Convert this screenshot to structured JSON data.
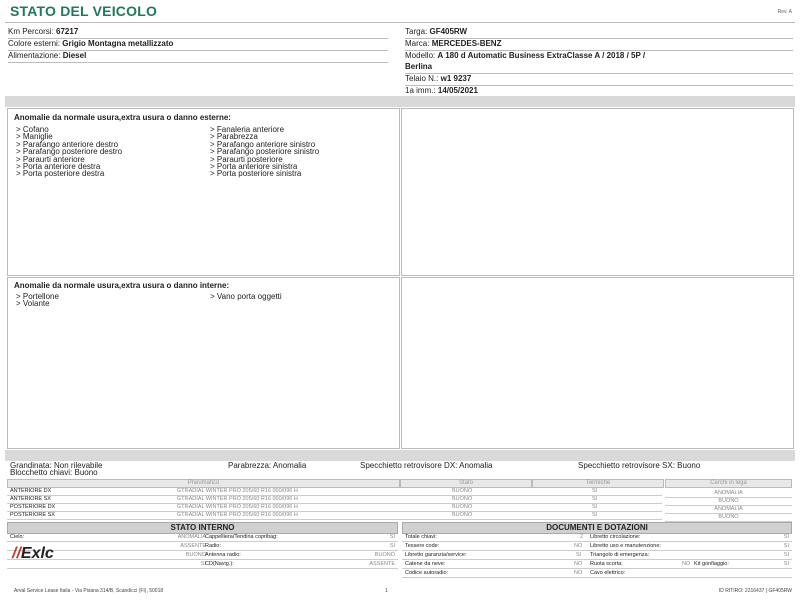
{
  "header": {
    "title": "STATO DEL VEICOLO",
    "rev": "Rev. A"
  },
  "vehicle_left": [
    {
      "label": "Km Percorsi:",
      "value": "67217"
    },
    {
      "label": "Colore esterni:",
      "value": "Grigio Montagna metallizzato"
    },
    {
      "label": "Alimentazione:",
      "value": "Diesel"
    }
  ],
  "vehicle_right": {
    "targa_label": "Targa:",
    "targa": "GF405RW",
    "marca_label": "Marca:",
    "marca": "MERCEDES-BENZ",
    "modello_label": "Modello:",
    "modello_1": "A 180 d Automatic Business ExtraClasse A / 2018 / 5P /",
    "modello_2": "Berlina",
    "telaio_label": "Telaio N.:",
    "telaio": "w1 9237",
    "imm_label": "1a imm.:",
    "imm": "14/05/2021"
  },
  "external": {
    "title": "Anomalie da normale usura,extra usura o danno esterne:",
    "col1": [
      "> Cofano",
      "> Maniglie",
      "> Parafango anteriore destro",
      "> Parafango posteriore destro",
      "> Paraurti anteriore",
      "> Porta anteriore destra",
      "> Porta posteriore destra"
    ],
    "col2": [
      "> Fanaleria anteriore",
      "> Parabrezza",
      "> Parafango anteriore sinistro",
      "> Parafango posteriore sinistro",
      "> Paraurti posteriore",
      "> Porta anteriore sinistra",
      "> Porta posteriore sinistra"
    ]
  },
  "internal": {
    "title": "Anomalie da normale usura,extra usura o danno interne:",
    "col1": [
      "> Portellone",
      "> Volante"
    ],
    "col2": [
      "> Vano porta oggetti"
    ]
  },
  "summary": {
    "grandinata": "Grandinata: Non rilevabile",
    "blocchetto": "Blocchetto chiavi: Buono",
    "parabrezza": "Parabrezza: Anomalia",
    "specchio_dx": "Specchietto retrovisore DX: Anomalia",
    "specchio_sx": "Specchietto retrovisore SX: Buono"
  },
  "tyres": {
    "headers": {
      "pneumatico": "Pneumatico",
      "stato": "Stato",
      "termiche": "Termiche",
      "cerchi": "Cerchi in lega"
    },
    "rows": [
      {
        "pos": "ANTERIORE DX",
        "tyre": "GTRADIAL  WINTER PRO 205/60 R16 000/096 H",
        "stato": "BUONO",
        "termiche": "SI",
        "cerchi": "ANOMALIA"
      },
      {
        "pos": "ANTERIORE SX",
        "tyre": "GTRADIAL  WINTER PRO 205/60 R16 000/096 H",
        "stato": "BUONO",
        "termiche": "SI",
        "cerchi": "BUONO"
      },
      {
        "pos": "POSTERIORE DX",
        "tyre": "GTRADIAL  WINTER PRO 205/60 R16 000/096 H",
        "stato": "BUONO",
        "termiche": "SI",
        "cerchi": "ANOMALIA"
      },
      {
        "pos": "POSTERIORE SX",
        "tyre": "GTRADIAL  WINTER PRO 205/60 R16 000/096 H",
        "stato": "BUONO",
        "termiche": "SI",
        "cerchi": "BUONO"
      }
    ]
  },
  "stato_interno": {
    "title": "STATO INTERNO",
    "rows": [
      {
        "a": "Cielo:",
        "av": "ANOMALIA",
        "b": "Cappelliera/Tendina copribag:",
        "bv": "SI"
      },
      {
        "a": "",
        "av": "ASSENTE",
        "b": "Radio:",
        "bv": "SI"
      },
      {
        "a": "",
        "av": "BUONO",
        "b": "Antenna radio:",
        "bv": "BUONO"
      },
      {
        "a": "",
        "av": "SI",
        "b": "CD(Navig.):",
        "bv": "ASSENTE"
      }
    ]
  },
  "documenti": {
    "title": "DOCUMENTI E DOTAZIONI",
    "rows": [
      {
        "a": "Totale chiavi:",
        "av": "2",
        "b": "Libretto circolazione:",
        "bv": "SI",
        "c": "",
        "cv": ""
      },
      {
        "a": "Tessere code:",
        "av": "NO",
        "b": "Libretto uso e manutenzione:",
        "bv": "SI",
        "c": "",
        "cv": ""
      },
      {
        "a": "Libretto garanzia/service:",
        "av": "SI",
        "b": "Triangolo di emergenza:",
        "bv": "SI",
        "c": "",
        "cv": ""
      },
      {
        "a": "Catene da neve:",
        "av": "NO",
        "b": "Ruota scorta:",
        "bv": "NO",
        "c": "Kit gonfiaggio:",
        "cv": "SI"
      },
      {
        "a": "Codice autoradio:",
        "av": "NO",
        "b": "Cavo elettrico:",
        "bv": "",
        "c": "",
        "cv": ""
      }
    ]
  },
  "footer": {
    "logo": "Exlc",
    "company": "Arval Service Lease Italia - Via Pisana 314/B, Scandicci (FI), 50018",
    "page": "1",
    "id": "ID RITIRO: 2216437 | GF405RW"
  },
  "colors": {
    "title": "#1f7a5a",
    "logo_mark": "#c0392b"
  }
}
